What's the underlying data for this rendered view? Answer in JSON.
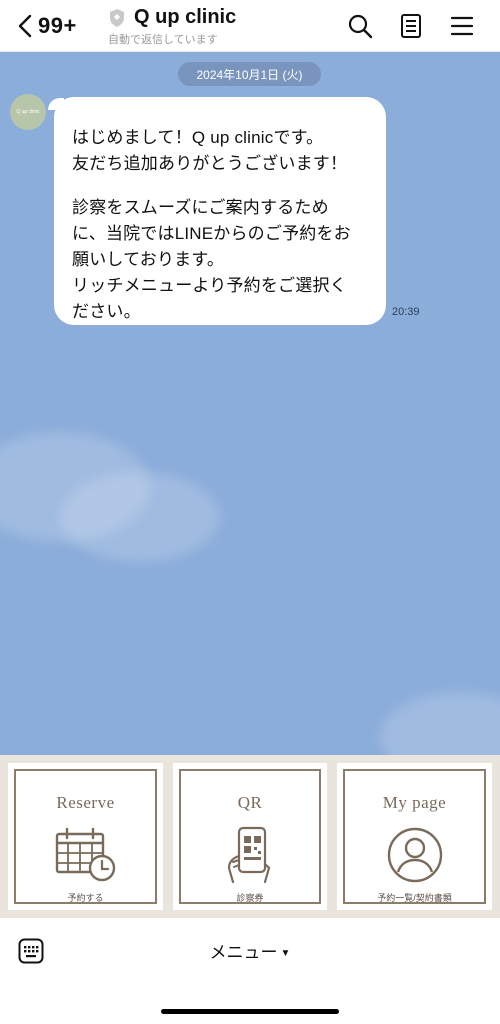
{
  "header": {
    "back_count": "99+",
    "title": "Q up clinic",
    "subtitle": "自動で返信しています"
  },
  "chat": {
    "date": "2024年10月1日 (火)",
    "avatar_text": "Q up clinic",
    "message_lines": [
      "はじめまして！Q up clinicです。",
      "友だち追加ありがとうございます！",
      "",
      "診察をスムーズにご案内するため",
      "に、当院ではLINEからのご予約をお",
      "願いしております。",
      "リッチメニューより予約をご選択く",
      "ださい。"
    ],
    "time": "20:39"
  },
  "richmenu": {
    "tiles": [
      {
        "title": "Reserve",
        "sub": "予約する",
        "icon": "calendar-clock-icon"
      },
      {
        "title": "QR",
        "sub": "診察券",
        "icon": "phone-qr-icon"
      },
      {
        "title": "My page",
        "sub": "予約一覧/契約書類",
        "icon": "user-circle-icon"
      }
    ]
  },
  "bottom": {
    "menu_label": "メニュー",
    "menu_arrow": "▼"
  },
  "colors": {
    "chat_bg": "#8badda",
    "richmenu_bg": "#e9e4dc",
    "tile_border": "#8c7c6c"
  }
}
